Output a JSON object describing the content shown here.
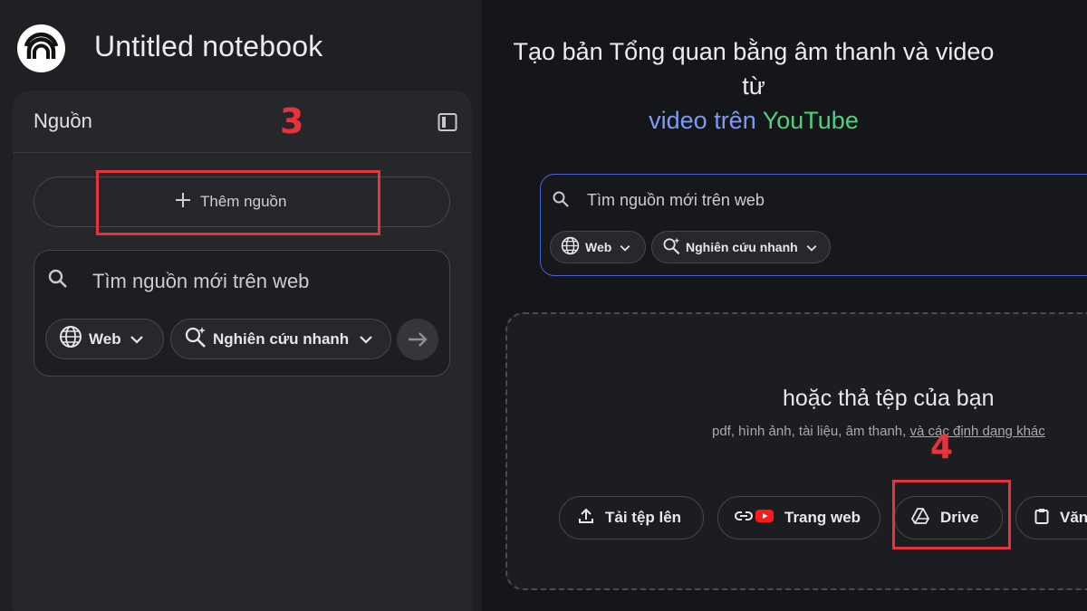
{
  "notebook": {
    "title": "Untitled notebook"
  },
  "sources_panel": {
    "title": "Nguồn",
    "step_number": "3",
    "add_source_label": "Thêm nguồn",
    "search_placeholder": "Tìm nguồn mới trên web",
    "web_chip": "Web",
    "research_chip": "Nghiên cứu nhanh"
  },
  "main": {
    "heading_line1": "Tạo bản Tổng quan bằng âm thanh và video",
    "heading_line2": "từ",
    "heading_video": "video trên",
    "heading_youtube": "YouTube",
    "search_placeholder": "Tìm nguồn mới trên web",
    "web_chip": "Web",
    "research_chip": "Nghiên cứu nhanh",
    "drop_title": "hoặc thả tệp của bạn",
    "drop_sub_plain": "pdf, hình ảnh, tài liệu, âm thanh, ",
    "drop_sub_link": "và các định dạng khác",
    "step_number": "4",
    "upload_button": "Tải tệp lên",
    "website_button": "Trang web",
    "drive_button": "Drive",
    "text_button": "Văn"
  },
  "colors": {
    "accent_red": "#e8333a",
    "link_blue": "#7d9bf2",
    "youtube_green": "#4fd17a",
    "search_border": "#4b62d6"
  }
}
